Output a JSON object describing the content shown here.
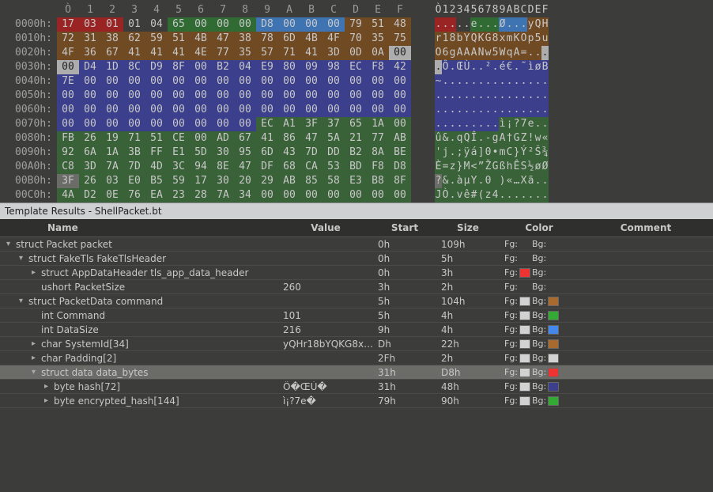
{
  "hex": {
    "col_headers": [
      "Ò",
      "1",
      "2",
      "3",
      "4",
      "5",
      "6",
      "7",
      "8",
      "9",
      "A",
      "B",
      "C",
      "D",
      "E",
      "F"
    ],
    "ascii_headers": [
      "Ò",
      "1",
      "2",
      "3",
      "4",
      "5",
      "6",
      "7",
      "8",
      "9",
      "A",
      "B",
      "C",
      "D",
      "E",
      "F"
    ],
    "rows": [
      {
        "offset": "0000h:",
        "bytes": [
          "17",
          "03",
          "01",
          "01",
          "04",
          "65",
          "00",
          "00",
          "00",
          "D8",
          "00",
          "00",
          "00",
          "79",
          "51",
          "48"
        ],
        "byteBg": [
          "red",
          "red",
          "red",
          "",
          "",
          "green",
          "green",
          "green",
          "green",
          "blue",
          "blue",
          "blue",
          "blue",
          "brown",
          "brown",
          "brown"
        ],
        "ascii": [
          ".",
          ".",
          ".",
          ".",
          ".",
          "e",
          ".",
          ".",
          ".",
          "Ø",
          ".",
          ".",
          ".",
          "y",
          "Q",
          "H"
        ],
        "asciiBg": [
          "red",
          "red",
          "red",
          "",
          "",
          "green",
          "green",
          "green",
          "green",
          "blue",
          "blue",
          "blue",
          "blue",
          "brown",
          "brown",
          "brown"
        ]
      },
      {
        "offset": "0010h:",
        "bytes": [
          "72",
          "31",
          "38",
          "62",
          "59",
          "51",
          "4B",
          "47",
          "38",
          "78",
          "6D",
          "4B",
          "4F",
          "70",
          "35",
          "75"
        ],
        "byteBg": [
          "brown",
          "brown",
          "brown",
          "brown",
          "brown",
          "brown",
          "brown",
          "brown",
          "brown",
          "brown",
          "brown",
          "brown",
          "brown",
          "brown",
          "brown",
          "brown"
        ],
        "ascii": [
          "r",
          "1",
          "8",
          "b",
          "Y",
          "Q",
          "K",
          "G",
          "8",
          "x",
          "m",
          "K",
          "O",
          "p",
          "5",
          "u"
        ],
        "asciiBg": [
          "brown",
          "brown",
          "brown",
          "brown",
          "brown",
          "brown",
          "brown",
          "brown",
          "brown",
          "brown",
          "brown",
          "brown",
          "brown",
          "brown",
          "brown",
          "brown"
        ]
      },
      {
        "offset": "0020h:",
        "bytes": [
          "4F",
          "36",
          "67",
          "41",
          "41",
          "41",
          "4E",
          "77",
          "35",
          "57",
          "71",
          "41",
          "3D",
          "0D",
          "0A",
          "00"
        ],
        "byteBg": [
          "brown",
          "brown",
          "brown",
          "brown",
          "brown",
          "brown",
          "brown",
          "brown",
          "brown",
          "brown",
          "brown",
          "brown",
          "brown",
          "brown",
          "brown",
          "lgray"
        ],
        "ascii": [
          "O",
          "6",
          "g",
          "A",
          "A",
          "A",
          "N",
          "w",
          "5",
          "W",
          "q",
          "A",
          "=",
          ".",
          ".",
          "."
        ],
        "asciiBg": [
          "brown",
          "brown",
          "brown",
          "brown",
          "brown",
          "brown",
          "brown",
          "brown",
          "brown",
          "brown",
          "brown",
          "brown",
          "brown",
          "brown",
          "brown",
          "lgray"
        ]
      },
      {
        "offset": "0030h:",
        "bytes": [
          "00",
          "D4",
          "1D",
          "8C",
          "D9",
          "8F",
          "00",
          "B2",
          "04",
          "E9",
          "80",
          "09",
          "98",
          "EC",
          "F8",
          "42"
        ],
        "byteBg": [
          "lgray",
          "navy",
          "navy",
          "navy",
          "navy",
          "navy",
          "navy",
          "navy",
          "navy",
          "navy",
          "navy",
          "navy",
          "navy",
          "navy",
          "navy",
          "navy"
        ],
        "ascii": [
          ".",
          "Ô",
          ".",
          "Œ",
          "Ù",
          ".",
          ".",
          "²",
          ".",
          "é",
          "€",
          ".",
          "˜",
          "ì",
          "ø",
          "B"
        ],
        "asciiBg": [
          "lgray",
          "navy",
          "navy",
          "navy",
          "navy",
          "navy",
          "navy",
          "navy",
          "navy",
          "navy",
          "navy",
          "navy",
          "navy",
          "navy",
          "navy",
          "navy"
        ]
      },
      {
        "offset": "0040h:",
        "bytes": [
          "7E",
          "00",
          "00",
          "00",
          "00",
          "00",
          "00",
          "00",
          "00",
          "00",
          "00",
          "00",
          "00",
          "00",
          "00",
          "00"
        ],
        "byteBg": [
          "navy",
          "navy",
          "navy",
          "navy",
          "navy",
          "navy",
          "navy",
          "navy",
          "navy",
          "navy",
          "navy",
          "navy",
          "navy",
          "navy",
          "navy",
          "navy"
        ],
        "ascii": [
          "~",
          ".",
          ".",
          ".",
          ".",
          ".",
          ".",
          ".",
          ".",
          ".",
          ".",
          ".",
          ".",
          ".",
          ".",
          "."
        ],
        "asciiBg": [
          "navy",
          "navy",
          "navy",
          "navy",
          "navy",
          "navy",
          "navy",
          "navy",
          "navy",
          "navy",
          "navy",
          "navy",
          "navy",
          "navy",
          "navy",
          "navy"
        ]
      },
      {
        "offset": "0050h:",
        "bytes": [
          "00",
          "00",
          "00",
          "00",
          "00",
          "00",
          "00",
          "00",
          "00",
          "00",
          "00",
          "00",
          "00",
          "00",
          "00",
          "00"
        ],
        "byteBg": [
          "navy",
          "navy",
          "navy",
          "navy",
          "navy",
          "navy",
          "navy",
          "navy",
          "navy",
          "navy",
          "navy",
          "navy",
          "navy",
          "navy",
          "navy",
          "navy"
        ],
        "ascii": [
          ".",
          ".",
          ".",
          ".",
          ".",
          ".",
          ".",
          ".",
          ".",
          ".",
          ".",
          ".",
          ".",
          ".",
          ".",
          "."
        ],
        "asciiBg": [
          "navy",
          "navy",
          "navy",
          "navy",
          "navy",
          "navy",
          "navy",
          "navy",
          "navy",
          "navy",
          "navy",
          "navy",
          "navy",
          "navy",
          "navy",
          "navy"
        ]
      },
      {
        "offset": "0060h:",
        "bytes": [
          "00",
          "00",
          "00",
          "00",
          "00",
          "00",
          "00",
          "00",
          "00",
          "00",
          "00",
          "00",
          "00",
          "00",
          "00",
          "00"
        ],
        "byteBg": [
          "navy",
          "navy",
          "navy",
          "navy",
          "navy",
          "navy",
          "navy",
          "navy",
          "navy",
          "navy",
          "navy",
          "navy",
          "navy",
          "navy",
          "navy",
          "navy"
        ],
        "ascii": [
          ".",
          ".",
          ".",
          ".",
          ".",
          ".",
          ".",
          ".",
          ".",
          ".",
          ".",
          ".",
          ".",
          ".",
          ".",
          "."
        ],
        "asciiBg": [
          "navy",
          "navy",
          "navy",
          "navy",
          "navy",
          "navy",
          "navy",
          "navy",
          "navy",
          "navy",
          "navy",
          "navy",
          "navy",
          "navy",
          "navy",
          "navy"
        ]
      },
      {
        "offset": "0070h:",
        "bytes": [
          "00",
          "00",
          "00",
          "00",
          "00",
          "00",
          "00",
          "00",
          "00",
          "EC",
          "A1",
          "3F",
          "37",
          "65",
          "1A",
          "00"
        ],
        "byteBg": [
          "navy",
          "navy",
          "navy",
          "navy",
          "navy",
          "navy",
          "navy",
          "navy",
          "navy",
          "dgreen",
          "dgreen",
          "dgreen",
          "dgreen",
          "dgreen",
          "dgreen",
          "dgreen"
        ],
        "ascii": [
          ".",
          ".",
          ".",
          ".",
          ".",
          ".",
          ".",
          ".",
          ".",
          "ì",
          "¡",
          "?",
          "7",
          "e",
          ".",
          "."
        ],
        "asciiBg": [
          "navy",
          "navy",
          "navy",
          "navy",
          "navy",
          "navy",
          "navy",
          "navy",
          "navy",
          "dgreen",
          "dgreen",
          "dgreen",
          "dgreen",
          "dgreen",
          "dgreen",
          "dgreen"
        ]
      },
      {
        "offset": "0080h:",
        "bytes": [
          "FB",
          "26",
          "19",
          "71",
          "51",
          "CE",
          "00",
          "AD",
          "67",
          "41",
          "86",
          "47",
          "5A",
          "21",
          "77",
          "AB"
        ],
        "byteBg": [
          "dgreen",
          "dgreen",
          "dgreen",
          "dgreen",
          "dgreen",
          "dgreen",
          "dgreen",
          "dgreen",
          "dgreen",
          "dgreen",
          "dgreen",
          "dgreen",
          "dgreen",
          "dgreen",
          "dgreen",
          "dgreen"
        ],
        "ascii": [
          "û",
          "&",
          ".",
          "q",
          "Q",
          "Î",
          ".",
          "-",
          "g",
          "A",
          "†",
          "G",
          "Z",
          "!",
          "w",
          "«"
        ],
        "asciiBg": [
          "dgreen",
          "dgreen",
          "dgreen",
          "dgreen",
          "dgreen",
          "dgreen",
          "dgreen",
          "dgreen",
          "dgreen",
          "dgreen",
          "dgreen",
          "dgreen",
          "dgreen",
          "dgreen",
          "dgreen",
          "dgreen"
        ]
      },
      {
        "offset": "0090h:",
        "bytes": [
          "92",
          "6A",
          "1A",
          "3B",
          "FF",
          "E1",
          "5D",
          "30",
          "95",
          "6D",
          "43",
          "7D",
          "DD",
          "B2",
          "8A",
          "BE"
        ],
        "byteBg": [
          "dgreen",
          "dgreen",
          "dgreen",
          "dgreen",
          "dgreen",
          "dgreen",
          "dgreen",
          "dgreen",
          "dgreen",
          "dgreen",
          "dgreen",
          "dgreen",
          "dgreen",
          "dgreen",
          "dgreen",
          "dgreen"
        ],
        "ascii": [
          "'",
          "j",
          ".",
          ";",
          "ÿ",
          "á",
          "]",
          "0",
          "•",
          "m",
          "C",
          "}",
          "Ý",
          "²",
          "Š",
          "¾"
        ],
        "asciiBg": [
          "dgreen",
          "dgreen",
          "dgreen",
          "dgreen",
          "dgreen",
          "dgreen",
          "dgreen",
          "dgreen",
          "dgreen",
          "dgreen",
          "dgreen",
          "dgreen",
          "dgreen",
          "dgreen",
          "dgreen",
          "dgreen"
        ]
      },
      {
        "offset": "00A0h:",
        "bytes": [
          "C8",
          "3D",
          "7A",
          "7D",
          "4D",
          "3C",
          "94",
          "8E",
          "47",
          "DF",
          "68",
          "CA",
          "53",
          "BD",
          "F8",
          "D8"
        ],
        "byteBg": [
          "dgreen",
          "dgreen",
          "dgreen",
          "dgreen",
          "dgreen",
          "dgreen",
          "dgreen",
          "dgreen",
          "dgreen",
          "dgreen",
          "dgreen",
          "dgreen",
          "dgreen",
          "dgreen",
          "dgreen",
          "dgreen"
        ],
        "ascii": [
          "È",
          "=",
          "z",
          "}",
          "M",
          "<",
          "”",
          "Ž",
          "G",
          "ß",
          "h",
          "Ê",
          "S",
          "½",
          "ø",
          "Ø"
        ],
        "asciiBg": [
          "dgreen",
          "dgreen",
          "dgreen",
          "dgreen",
          "dgreen",
          "dgreen",
          "dgreen",
          "dgreen",
          "dgreen",
          "dgreen",
          "dgreen",
          "dgreen",
          "dgreen",
          "dgreen",
          "dgreen",
          "dgreen"
        ]
      },
      {
        "offset": "00B0h:",
        "bytes": [
          "3F",
          "26",
          "03",
          "E0",
          "B5",
          "59",
          "17",
          "30",
          "20",
          "29",
          "AB",
          "85",
          "58",
          "E3",
          "B8",
          "8F"
        ],
        "byteBg": [
          "sel",
          "dgreen",
          "dgreen",
          "dgreen",
          "dgreen",
          "dgreen",
          "dgreen",
          "dgreen",
          "dgreen",
          "dgreen",
          "dgreen",
          "dgreen",
          "dgreen",
          "dgreen",
          "dgreen",
          "dgreen"
        ],
        "ascii": [
          "?",
          "&",
          ".",
          "à",
          "µ",
          "Y",
          ".",
          "0",
          " ",
          ")",
          "«",
          "…",
          "X",
          "ã",
          ".",
          "."
        ],
        "asciiBg": [
          "sel",
          "dgreen",
          "dgreen",
          "dgreen",
          "dgreen",
          "dgreen",
          "dgreen",
          "dgreen",
          "dgreen",
          "dgreen",
          "dgreen",
          "dgreen",
          "dgreen",
          "dgreen",
          "dgreen",
          "dgreen"
        ]
      },
      {
        "offset": "00C0h:",
        "bytes": [
          "4A",
          "D2",
          "0E",
          "76",
          "EA",
          "23",
          "28",
          "7A",
          "34",
          "00",
          "00",
          "00",
          "00",
          "00",
          "00",
          "00"
        ],
        "byteBg": [
          "dgreen",
          "dgreen",
          "dgreen",
          "dgreen",
          "dgreen",
          "dgreen",
          "dgreen",
          "dgreen",
          "dgreen",
          "dgreen",
          "dgreen",
          "dgreen",
          "dgreen",
          "dgreen",
          "dgreen",
          "dgreen"
        ],
        "ascii": [
          "J",
          "Ò",
          ".",
          "v",
          "ê",
          "#",
          "(",
          "z",
          "4",
          ".",
          ".",
          ".",
          ".",
          ".",
          ".",
          "."
        ],
        "asciiBg": [
          "dgreen",
          "dgreen",
          "dgreen",
          "dgreen",
          "dgreen",
          "dgreen",
          "dgreen",
          "dgreen",
          "dgreen",
          "dgreen",
          "dgreen",
          "dgreen",
          "dgreen",
          "dgreen",
          "dgreen",
          "dgreen"
        ]
      }
    ]
  },
  "panel_title": "Template Results - ShellPacket.bt",
  "columns": {
    "name": "Name",
    "value": "Value",
    "start": "Start",
    "size": "Size",
    "color": "Color",
    "comment": "Comment"
  },
  "labels": {
    "fg": "Fg:",
    "bg": "Bg:"
  },
  "tree": [
    {
      "indent": 0,
      "tw": "▾",
      "name": "struct Packet packet",
      "value": "",
      "start": "0h",
      "size": "109h",
      "fg": "none",
      "bg": "none"
    },
    {
      "indent": 1,
      "tw": "▾",
      "name": "struct FakeTls FakeTlsHeader",
      "value": "",
      "start": "0h",
      "size": "5h",
      "fg": "none",
      "bg": "none"
    },
    {
      "indent": 2,
      "tw": "▸",
      "name": "struct AppDataHeader tls_app_data_header",
      "value": "",
      "start": "0h",
      "size": "3h",
      "fg": "red",
      "bg": "none"
    },
    {
      "indent": 2,
      "tw": "",
      "name": "ushort PacketSize",
      "value": "260",
      "start": "3h",
      "size": "2h",
      "fg": "none",
      "bg": "none"
    },
    {
      "indent": 1,
      "tw": "▾",
      "name": "struct PacketData command",
      "value": "",
      "start": "5h",
      "size": "104h",
      "fg": "lgray",
      "bg": "brown"
    },
    {
      "indent": 2,
      "tw": "",
      "name": "int Command",
      "value": "101",
      "start": "5h",
      "size": "4h",
      "fg": "lgray",
      "bg": "green"
    },
    {
      "indent": 2,
      "tw": "",
      "name": "int DataSize",
      "value": "216",
      "start": "9h",
      "size": "4h",
      "fg": "lgray",
      "bg": "blue"
    },
    {
      "indent": 2,
      "tw": "▸",
      "name": "char SystemId[34]",
      "value": "yQHr18bYQKG8x…",
      "start": "Dh",
      "size": "22h",
      "fg": "lgray",
      "bg": "brown"
    },
    {
      "indent": 2,
      "tw": "▸",
      "name": "char Padding[2]",
      "value": "",
      "start": "2Fh",
      "size": "2h",
      "fg": "lgray",
      "bg": "lgray"
    },
    {
      "indent": 2,
      "tw": "▾",
      "name": "struct data data_bytes",
      "value": "",
      "start": "31h",
      "size": "D8h",
      "fg": "lgray",
      "bg": "red",
      "selected": true
    },
    {
      "indent": 3,
      "tw": "▸",
      "name": "byte hash[72]",
      "value": "Ô�ŒÙ�",
      "start": "31h",
      "size": "48h",
      "fg": "lgray",
      "bg": "navy"
    },
    {
      "indent": 3,
      "tw": "▸",
      "name": "byte encrypted_hash[144]",
      "value": "ì¡?7e�",
      "start": "79h",
      "size": "90h",
      "fg": "lgray",
      "bg": "green"
    }
  ]
}
